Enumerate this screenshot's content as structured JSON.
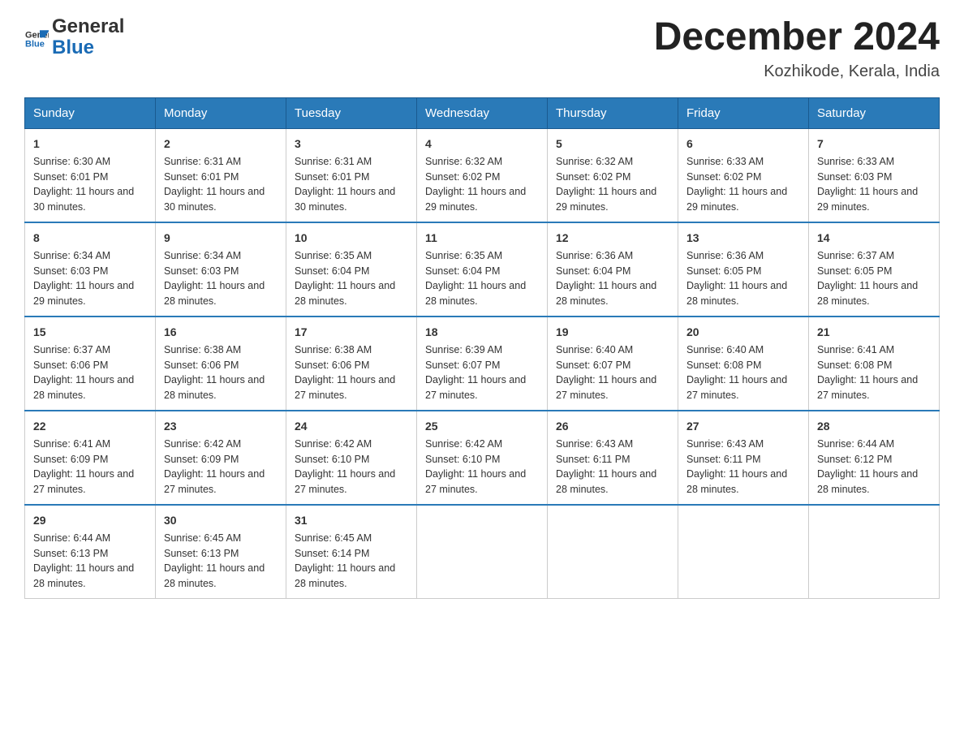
{
  "header": {
    "logo_general": "General",
    "logo_blue": "Blue",
    "month_title": "December 2024",
    "location": "Kozhikode, Kerala, India"
  },
  "days_of_week": [
    "Sunday",
    "Monday",
    "Tuesday",
    "Wednesday",
    "Thursday",
    "Friday",
    "Saturday"
  ],
  "weeks": [
    [
      {
        "day": "1",
        "sunrise": "6:30 AM",
        "sunset": "6:01 PM",
        "daylight": "11 hours and 30 minutes."
      },
      {
        "day": "2",
        "sunrise": "6:31 AM",
        "sunset": "6:01 PM",
        "daylight": "11 hours and 30 minutes."
      },
      {
        "day": "3",
        "sunrise": "6:31 AM",
        "sunset": "6:01 PM",
        "daylight": "11 hours and 30 minutes."
      },
      {
        "day": "4",
        "sunrise": "6:32 AM",
        "sunset": "6:02 PM",
        "daylight": "11 hours and 29 minutes."
      },
      {
        "day": "5",
        "sunrise": "6:32 AM",
        "sunset": "6:02 PM",
        "daylight": "11 hours and 29 minutes."
      },
      {
        "day": "6",
        "sunrise": "6:33 AM",
        "sunset": "6:02 PM",
        "daylight": "11 hours and 29 minutes."
      },
      {
        "day": "7",
        "sunrise": "6:33 AM",
        "sunset": "6:03 PM",
        "daylight": "11 hours and 29 minutes."
      }
    ],
    [
      {
        "day": "8",
        "sunrise": "6:34 AM",
        "sunset": "6:03 PM",
        "daylight": "11 hours and 29 minutes."
      },
      {
        "day": "9",
        "sunrise": "6:34 AM",
        "sunset": "6:03 PM",
        "daylight": "11 hours and 28 minutes."
      },
      {
        "day": "10",
        "sunrise": "6:35 AM",
        "sunset": "6:04 PM",
        "daylight": "11 hours and 28 minutes."
      },
      {
        "day": "11",
        "sunrise": "6:35 AM",
        "sunset": "6:04 PM",
        "daylight": "11 hours and 28 minutes."
      },
      {
        "day": "12",
        "sunrise": "6:36 AM",
        "sunset": "6:04 PM",
        "daylight": "11 hours and 28 minutes."
      },
      {
        "day": "13",
        "sunrise": "6:36 AM",
        "sunset": "6:05 PM",
        "daylight": "11 hours and 28 minutes."
      },
      {
        "day": "14",
        "sunrise": "6:37 AM",
        "sunset": "6:05 PM",
        "daylight": "11 hours and 28 minutes."
      }
    ],
    [
      {
        "day": "15",
        "sunrise": "6:37 AM",
        "sunset": "6:06 PM",
        "daylight": "11 hours and 28 minutes."
      },
      {
        "day": "16",
        "sunrise": "6:38 AM",
        "sunset": "6:06 PM",
        "daylight": "11 hours and 28 minutes."
      },
      {
        "day": "17",
        "sunrise": "6:38 AM",
        "sunset": "6:06 PM",
        "daylight": "11 hours and 27 minutes."
      },
      {
        "day": "18",
        "sunrise": "6:39 AM",
        "sunset": "6:07 PM",
        "daylight": "11 hours and 27 minutes."
      },
      {
        "day": "19",
        "sunrise": "6:40 AM",
        "sunset": "6:07 PM",
        "daylight": "11 hours and 27 minutes."
      },
      {
        "day": "20",
        "sunrise": "6:40 AM",
        "sunset": "6:08 PM",
        "daylight": "11 hours and 27 minutes."
      },
      {
        "day": "21",
        "sunrise": "6:41 AM",
        "sunset": "6:08 PM",
        "daylight": "11 hours and 27 minutes."
      }
    ],
    [
      {
        "day": "22",
        "sunrise": "6:41 AM",
        "sunset": "6:09 PM",
        "daylight": "11 hours and 27 minutes."
      },
      {
        "day": "23",
        "sunrise": "6:42 AM",
        "sunset": "6:09 PM",
        "daylight": "11 hours and 27 minutes."
      },
      {
        "day": "24",
        "sunrise": "6:42 AM",
        "sunset": "6:10 PM",
        "daylight": "11 hours and 27 minutes."
      },
      {
        "day": "25",
        "sunrise": "6:42 AM",
        "sunset": "6:10 PM",
        "daylight": "11 hours and 27 minutes."
      },
      {
        "day": "26",
        "sunrise": "6:43 AM",
        "sunset": "6:11 PM",
        "daylight": "11 hours and 28 minutes."
      },
      {
        "day": "27",
        "sunrise": "6:43 AM",
        "sunset": "6:11 PM",
        "daylight": "11 hours and 28 minutes."
      },
      {
        "day": "28",
        "sunrise": "6:44 AM",
        "sunset": "6:12 PM",
        "daylight": "11 hours and 28 minutes."
      }
    ],
    [
      {
        "day": "29",
        "sunrise": "6:44 AM",
        "sunset": "6:13 PM",
        "daylight": "11 hours and 28 minutes."
      },
      {
        "day": "30",
        "sunrise": "6:45 AM",
        "sunset": "6:13 PM",
        "daylight": "11 hours and 28 minutes."
      },
      {
        "day": "31",
        "sunrise": "6:45 AM",
        "sunset": "6:14 PM",
        "daylight": "11 hours and 28 minutes."
      },
      null,
      null,
      null,
      null
    ]
  ]
}
